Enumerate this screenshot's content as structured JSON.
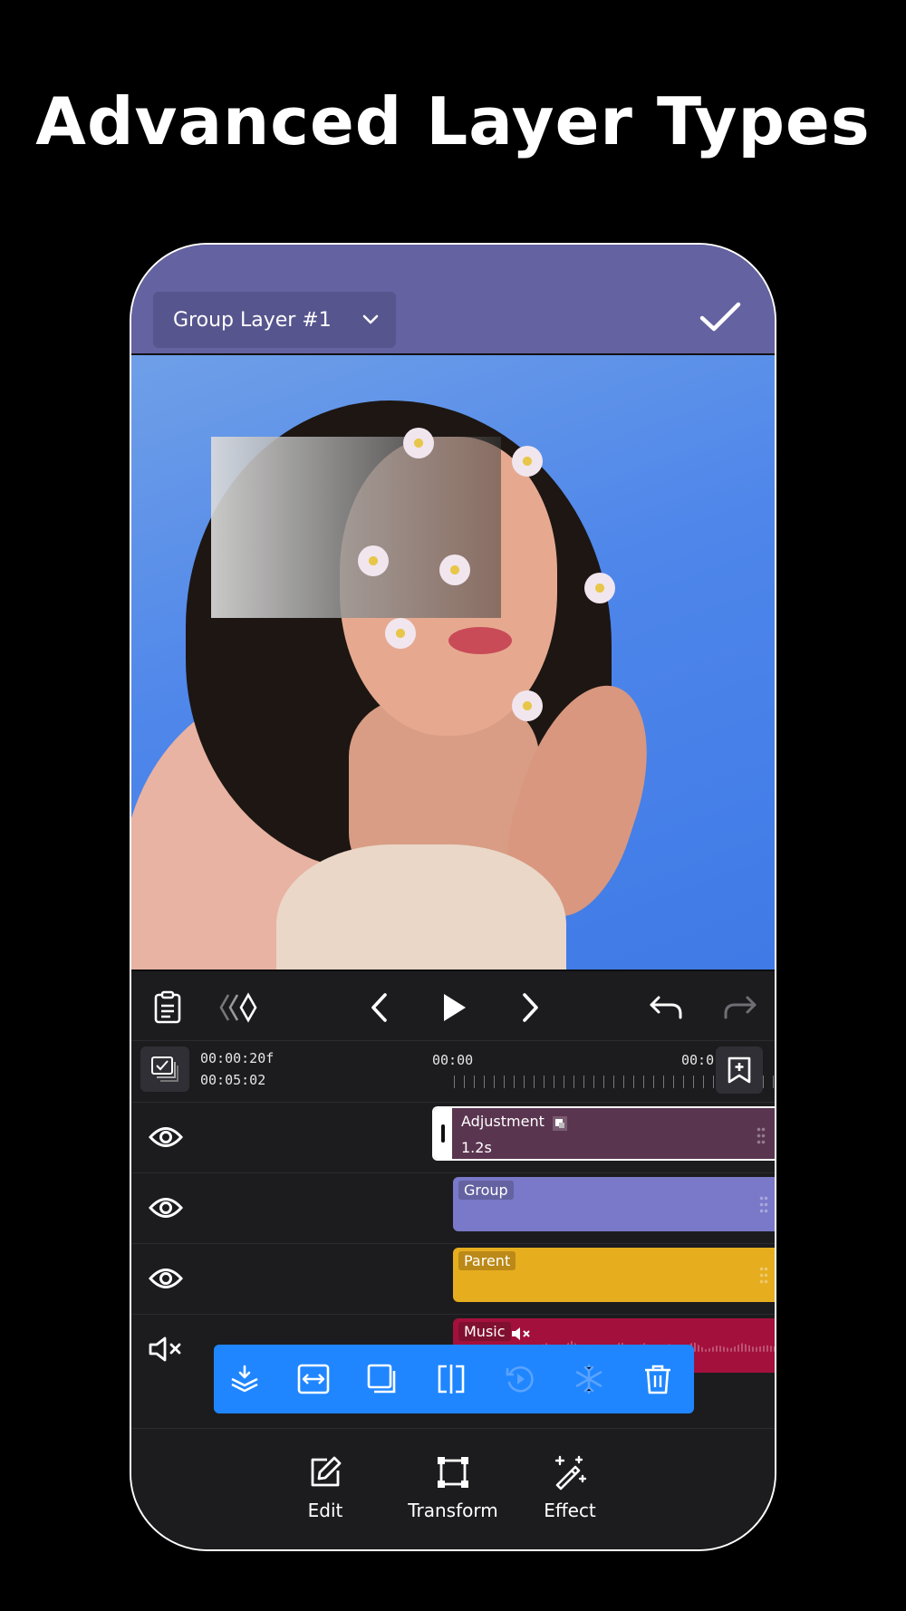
{
  "headline": "Advanced Layer Types",
  "topbar": {
    "layer_selector": "Group Layer #1"
  },
  "timeline": {
    "timecode_current": "00:00:20f",
    "timecode_total": "00:05:02",
    "ruler_start": "00:00",
    "ruler_next": "00:0"
  },
  "tracks": [
    {
      "label": "Adjustment",
      "duration": "1.2s",
      "color": "#5a3550"
    },
    {
      "label": "Group",
      "color": "#7a78c9"
    },
    {
      "label": "Parent",
      "color": "#e6ad1f"
    },
    {
      "label": "Music",
      "color": "#a3103c"
    }
  ],
  "bottom_nav": {
    "edit": "Edit",
    "transform": "Transform",
    "effect": "Effect"
  },
  "colors": {
    "topbar": "#6462a1",
    "action_bar": "#1f86ff",
    "panel": "#1c1c1f"
  },
  "icons": {
    "controls": [
      "clipboard-icon",
      "keyframe-diamonds-icon",
      "prev-frame-icon",
      "play-icon",
      "next-frame-icon",
      "undo-icon",
      "redo-icon"
    ],
    "actions": [
      "layers-icon",
      "fit-width-icon",
      "duplicate-icon",
      "split-icon",
      "rotate-icon",
      "freeze-icon",
      "trash-icon"
    ]
  }
}
